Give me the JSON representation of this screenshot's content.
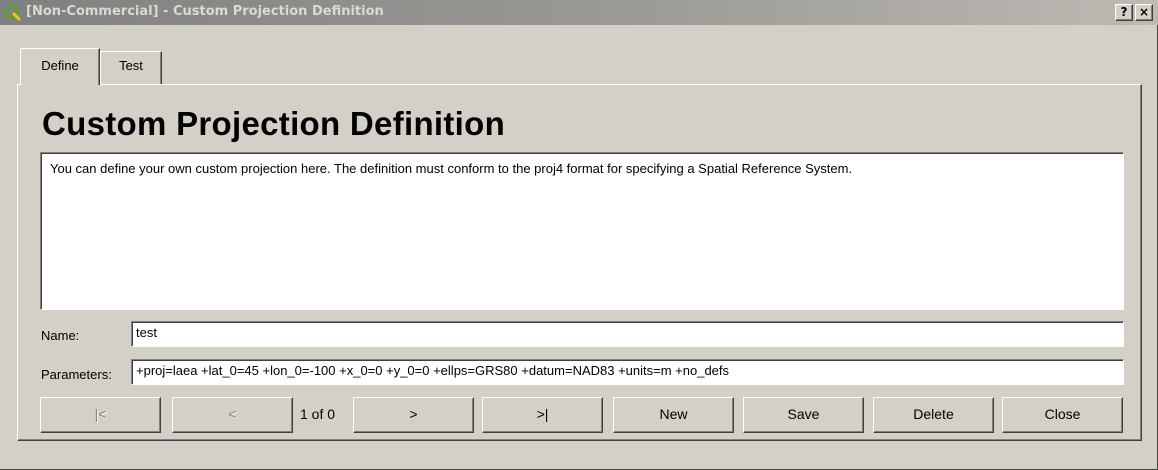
{
  "window": {
    "title": "[Non-Commercial] - Custom Projection Definition",
    "help_label": "?",
    "close_label": "×"
  },
  "tabs": [
    {
      "label": "Define",
      "active": true
    },
    {
      "label": "Test",
      "active": false
    }
  ],
  "main": {
    "heading": "Custom Projection Definition",
    "description": "You can define your own custom projection here. The definition must conform to the proj4 format for specifying a Spatial Reference System."
  },
  "form": {
    "name_label": "Name:",
    "name_value": "test",
    "params_label": "Parameters:",
    "params_value": "+proj=laea +lat_0=45 +lon_0=-100 +x_0=0 +y_0=0 +ellps=GRS80 +datum=NAD83 +units=m +no_defs"
  },
  "buttons": {
    "first": "|<",
    "prev": "<",
    "record_count": "1 of 0",
    "next": ">",
    "last": ">|",
    "new": "New",
    "save": "Save",
    "delete": "Delete",
    "close": "Close"
  },
  "colors": {
    "face": "#d4d0c8",
    "titlebar_inactive": "#808080",
    "app_icon": "#4a9a2a"
  }
}
